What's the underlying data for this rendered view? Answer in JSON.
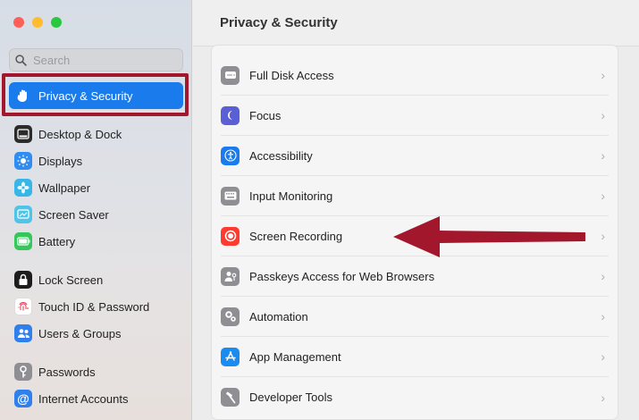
{
  "window": {
    "traffic_lights": {
      "close": "#ff5f57",
      "minimize": "#febc2e",
      "zoom": "#28c840"
    }
  },
  "sidebar": {
    "search_placeholder": "Search",
    "items": [
      {
        "label": "Privacy & Security",
        "icon": "hand-icon",
        "selected": true
      },
      {
        "label": "Desktop & Dock",
        "icon": "dock-icon"
      },
      {
        "label": "Displays",
        "icon": "sun-icon"
      },
      {
        "label": "Wallpaper",
        "icon": "flower-icon"
      },
      {
        "label": "Screen Saver",
        "icon": "screensaver-icon"
      },
      {
        "label": "Battery",
        "icon": "battery-icon"
      },
      {
        "label": "Lock Screen",
        "icon": "lock-icon"
      },
      {
        "label": "Touch ID & Password",
        "icon": "fingerprint-icon"
      },
      {
        "label": "Users & Groups",
        "icon": "users-icon"
      },
      {
        "label": "Passwords",
        "icon": "key-icon"
      },
      {
        "label": "Internet Accounts",
        "icon": "at-icon"
      }
    ]
  },
  "main": {
    "title": "Privacy & Security",
    "rows": [
      {
        "label": "Full Disk Access",
        "icon": "disk-icon"
      },
      {
        "label": "Focus",
        "icon": "moon-icon"
      },
      {
        "label": "Accessibility",
        "icon": "accessibility-icon"
      },
      {
        "label": "Input Monitoring",
        "icon": "keyboard-icon"
      },
      {
        "label": "Screen Recording",
        "icon": "record-icon"
      },
      {
        "label": "Passkeys Access for Web Browsers",
        "icon": "passkey-icon"
      },
      {
        "label": "Automation",
        "icon": "gears-icon"
      },
      {
        "label": "App Management",
        "icon": "appstore-icon"
      },
      {
        "label": "Developer Tools",
        "icon": "hammer-icon"
      }
    ],
    "chevron": "›"
  },
  "colors": {
    "accent": "#1a7bec",
    "annotation": "#a3172d"
  }
}
